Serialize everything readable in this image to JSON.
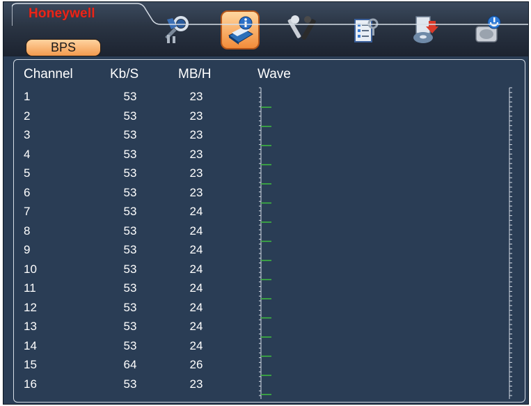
{
  "brand": "Honeywell",
  "tab": {
    "label": "BPS"
  },
  "menu_icons": [
    "search-icon",
    "info-icon",
    "tools-icon",
    "checklist-icon",
    "backup-icon",
    "shutdown-icon"
  ],
  "columns": {
    "channel": "Channel",
    "kbs": "Kb/S",
    "mbh": "MB/H",
    "wave": "Wave"
  },
  "rows": [
    {
      "channel": "1",
      "kbs": "53",
      "mbh": "23"
    },
    {
      "channel": "2",
      "kbs": "53",
      "mbh": "23"
    },
    {
      "channel": "3",
      "kbs": "53",
      "mbh": "23"
    },
    {
      "channel": "4",
      "kbs": "53",
      "mbh": "23"
    },
    {
      "channel": "5",
      "kbs": "53",
      "mbh": "23"
    },
    {
      "channel": "6",
      "kbs": "53",
      "mbh": "23"
    },
    {
      "channel": "7",
      "kbs": "53",
      "mbh": "24"
    },
    {
      "channel": "8",
      "kbs": "53",
      "mbh": "24"
    },
    {
      "channel": "9",
      "kbs": "53",
      "mbh": "24"
    },
    {
      "channel": "10",
      "kbs": "53",
      "mbh": "24"
    },
    {
      "channel": "11",
      "kbs": "53",
      "mbh": "24"
    },
    {
      "channel": "12",
      "kbs": "53",
      "mbh": "24"
    },
    {
      "channel": "13",
      "kbs": "53",
      "mbh": "24"
    },
    {
      "channel": "14",
      "kbs": "53",
      "mbh": "24"
    },
    {
      "channel": "15",
      "kbs": "64",
      "mbh": "26"
    },
    {
      "channel": "16",
      "kbs": "53",
      "mbh": "23"
    }
  ],
  "colors": {
    "brand": "#e8261a",
    "panel_bg": "#2a3d55",
    "tab_orange": "#f39a4e",
    "wave_line": "#3fbf3f"
  }
}
